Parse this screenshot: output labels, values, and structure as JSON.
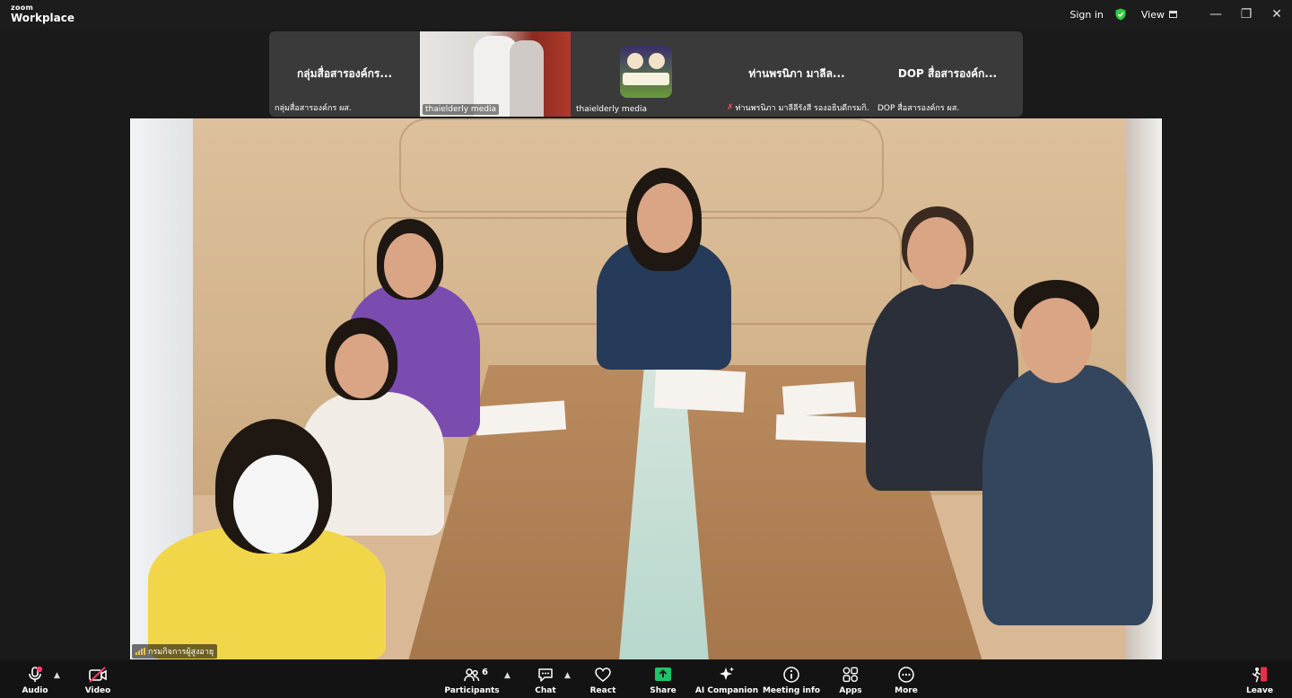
{
  "titlebar": {
    "logo_top": "zoom",
    "logo_bottom": "Workplace",
    "sign_in": "Sign in",
    "view": "View"
  },
  "thumbnails": [
    {
      "big_name": "กลุ่มสื่อสารองค์กร...",
      "tag": "กลุ่มสื่อสารองค์กร ผส."
    },
    {
      "big_name": "",
      "tag": "thaielderly media"
    },
    {
      "big_name": "",
      "tag": "thaielderly media"
    },
    {
      "big_name": "ท่านพรนิภา มาลีล...",
      "tag": "ท่านพรนิภา มาลีลีรังสี รองอธิบดีกรมกิ..."
    },
    {
      "big_name": "DOP สื่อสารองค์ก...",
      "tag": "DOP สื่อสารองค์กร ผส."
    }
  ],
  "main_video": {
    "name_tag": "กรมกิจการผู้สูงอายุ"
  },
  "toolbar": {
    "audio": "Audio",
    "video": "Video",
    "participants": "Participants",
    "participants_count": "6",
    "chat": "Chat",
    "react": "React",
    "share": "Share",
    "ai_companion": "AI Companion",
    "meeting_info": "Meeting info",
    "apps": "Apps",
    "more": "More",
    "leave": "Leave"
  },
  "colors": {
    "share_green": "#1ec46a",
    "shield_green": "#2ecc40",
    "mic_red": "#ff3c6e",
    "leave_red": "#e5304a"
  }
}
